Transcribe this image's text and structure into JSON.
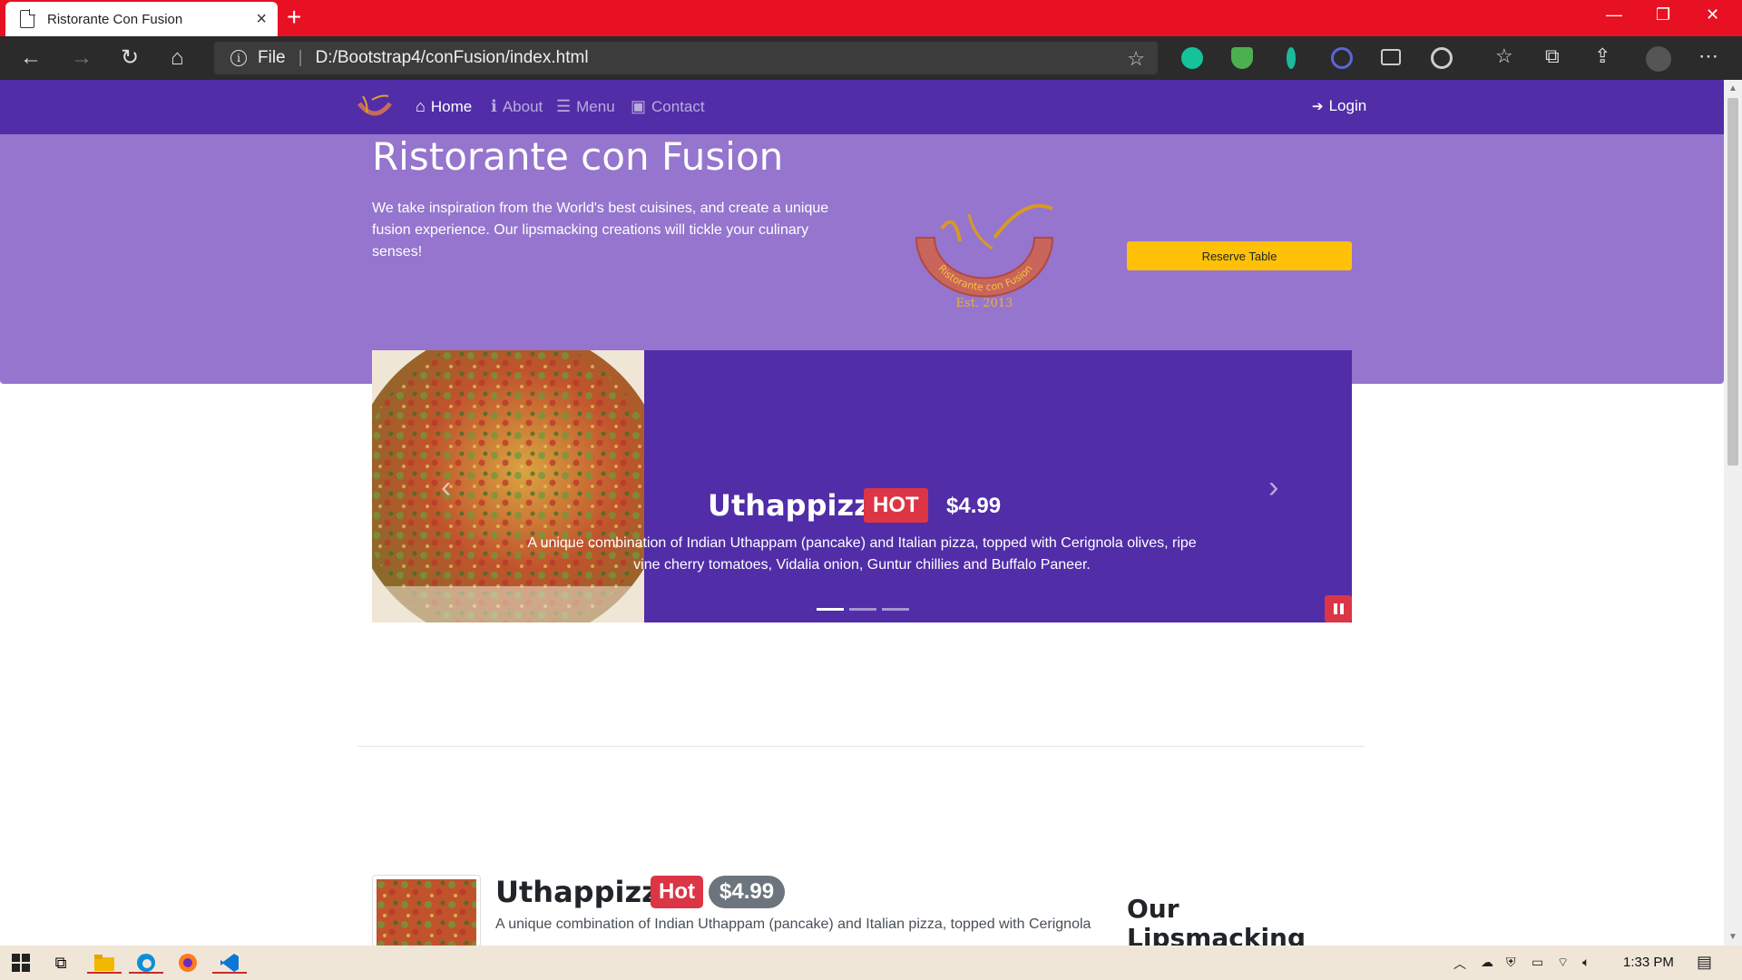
{
  "browser": {
    "tab_title": "Ristorante Con Fusion",
    "url_scheme": "File",
    "url": "D:/Bootstrap4/conFusion/index.html"
  },
  "navbar": {
    "items": [
      {
        "label": "Home",
        "icon": "home-icon",
        "active": true
      },
      {
        "label": "About",
        "icon": "info-icon",
        "active": false
      },
      {
        "label": "Menu",
        "icon": "list-icon",
        "active": false
      },
      {
        "label": "Contact",
        "icon": "address-card-icon",
        "active": false
      }
    ],
    "login_label": "Login"
  },
  "jumbotron": {
    "title": "Ristorante con Fusion",
    "text": "We take inspiration from the World's best cuisines, and create a unique fusion experience. Our lipsmacking creations will tickle your culinary senses!",
    "logo_text": "Ristorante con Fusion",
    "logo_est": "Est. 2013",
    "reserve_label": "Reserve Table"
  },
  "carousel": {
    "title": "Uthappizza",
    "badge": "HOT",
    "price": "$4.99",
    "text": "A unique combination of Indian Uthappam (pancake) and Italian pizza, topped with Cerignola olives, ripe vine cherry tomatoes, Vidalia onion, Guntur chillies and Buffalo Paneer.",
    "indicators": 3,
    "active_indicator": 0
  },
  "media": {
    "title": "Uthappizza",
    "badge": "Hot",
    "price": "$4.99",
    "text": "A unique combination of Indian Uthappam (pancake) and Italian pizza, topped with Cerignola"
  },
  "aside": {
    "title": "Our Lipsmacking Culinary Creations"
  },
  "taskbar": {
    "time": "1:33 PM"
  },
  "colors": {
    "navbar": "#512da8",
    "jumbotron": "#9575cd",
    "reserve_button": "#ffc107",
    "hot_badge": "#dc3545",
    "price_badge": "#6c757d",
    "titlebar": "#e81123"
  }
}
